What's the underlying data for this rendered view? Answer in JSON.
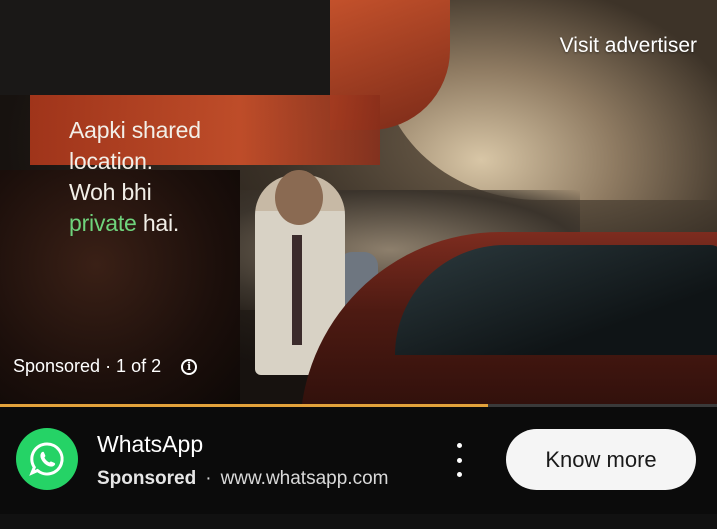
{
  "ad": {
    "caption_line1": "Aapki shared",
    "caption_line2": "location.",
    "caption_line3": "Woh bhi",
    "caption_green": "private",
    "caption_end": " hai.",
    "visit_label": "Visit advertiser",
    "sponsored_label": "Sponsored · 1 of 2",
    "progress": 0.68
  },
  "advertiser": {
    "name": "WhatsApp",
    "sponsored": "Sponsored",
    "separator": "·",
    "url": "www.whatsapp.com",
    "cta_label": "Know more"
  },
  "colors": {
    "whatsapp_green": "#25d366",
    "progress": "#e3a23b",
    "caption_accent": "#6fd37c"
  },
  "icons": [
    "whatsapp-logo-icon",
    "info-icon",
    "more-vertical-icon"
  ]
}
